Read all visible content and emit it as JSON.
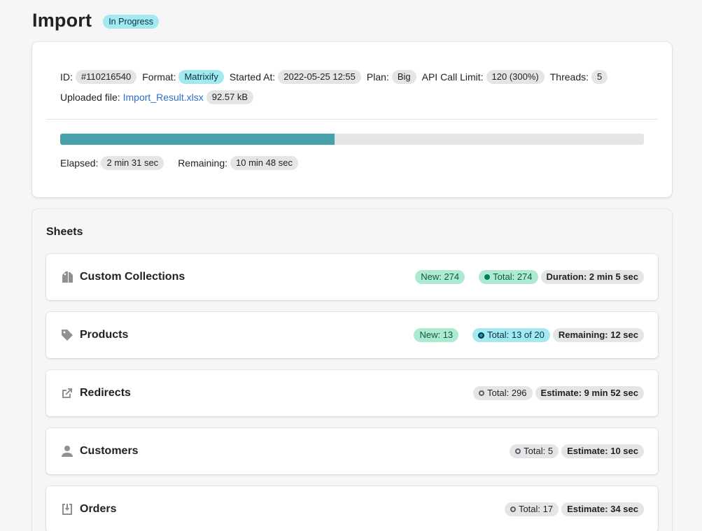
{
  "header": {
    "title": "Import",
    "status": "In Progress"
  },
  "info": {
    "id_label": "ID:",
    "id_value": "#110216540",
    "format_label": "Format:",
    "format_value": "Matrixify",
    "started_label": "Started At:",
    "started_value": "2022-05-25 12:55",
    "plan_label": "Plan:",
    "plan_value": "Big",
    "api_label": "API Call Limit:",
    "api_value": "120 (300%)",
    "threads_label": "Threads:",
    "threads_value": "5",
    "uploaded_label": "Uploaded file:",
    "uploaded_file": "Import_Result.xlsx",
    "uploaded_size": "92.57 kB",
    "progress_fraction": 0.47,
    "elapsed_label": "Elapsed:",
    "elapsed_value": "2 min 31 sec",
    "remaining_label": "Remaining:",
    "remaining_value": "10 min 48 sec"
  },
  "colors": {
    "accent": "#47a1ab",
    "status_badge": "#a4e8f2",
    "new_badge": "#aee9d1"
  },
  "sheets": {
    "title": "Sheets",
    "items": [
      {
        "name": "Custom Collections",
        "icon": "collections-icon",
        "new": "New: 274",
        "total": "Total: 274",
        "extra": "Duration: 2 min 5 sec"
      },
      {
        "name": "Products",
        "icon": "tag-icon",
        "new": "New: 13",
        "total": "Total: 13 of 20",
        "extra": "Remaining: 12 sec"
      },
      {
        "name": "Redirects",
        "icon": "external-link-icon",
        "total": "Total: 296",
        "extra": "Estimate: 9 min 52 sec"
      },
      {
        "name": "Customers",
        "icon": "person-icon",
        "total": "Total: 5",
        "extra": "Estimate: 10 sec"
      },
      {
        "name": "Orders",
        "icon": "import-icon",
        "total": "Total: 17",
        "extra": "Estimate: 34 sec"
      }
    ]
  }
}
